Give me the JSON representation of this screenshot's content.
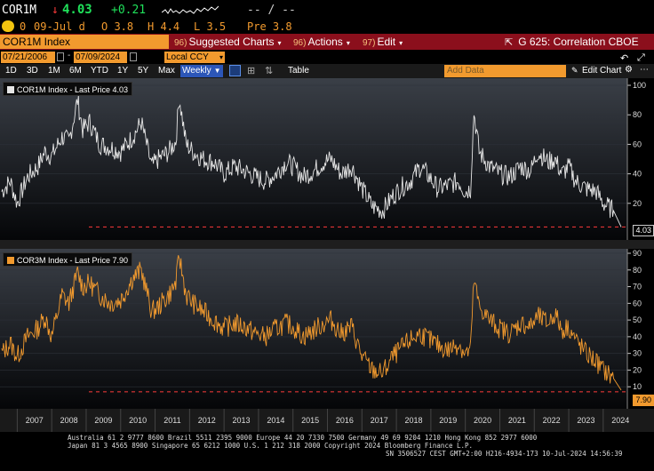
{
  "ticker": {
    "symbol": "COR1M",
    "arrow": "↓",
    "last": "4.03",
    "change": "+0.21",
    "trail": "-- / --"
  },
  "ohlc": {
    "badge": "0",
    "date": "09-Jul d",
    "open": "O 3.8",
    "high": "H 4.4",
    "low": "L 3.5",
    "prev": "Pre 3.8"
  },
  "commandbar": {
    "security": "COR1M Index",
    "menus": [
      {
        "num": "96)",
        "label": "Suggested Charts"
      },
      {
        "num": "96)",
        "label": "Actions"
      },
      {
        "num": "97)",
        "label": "Edit"
      }
    ],
    "title": "G 625: Correlation CBOE"
  },
  "dates": {
    "start": "07/21/2006",
    "end": "07/09/2024",
    "currency": "Local CCY"
  },
  "toolbar": {
    "periods": [
      "1D",
      "3D",
      "1M",
      "6M",
      "YTD",
      "1Y",
      "5Y",
      "Max"
    ],
    "frequency": "Weekly",
    "table": "Table",
    "add_data": "Add Data",
    "edit_chart": "Edit Chart"
  },
  "colors": {
    "series1": "#e6e6e6",
    "series2": "#f29a2e",
    "reference": "#ff3b3b",
    "bar": "#8b0f1c"
  },
  "chart_data": [
    {
      "type": "line",
      "name": "COR1M Index - Last Price 4.03",
      "last": "4.03",
      "ylim": [
        0,
        100
      ],
      "yticks": [
        20,
        40,
        60,
        80,
        100
      ],
      "reference_y": 4,
      "x": [
        2006.55,
        2006.8,
        2007.0,
        2007.3,
        2007.6,
        2007.8,
        2008.0,
        2008.3,
        2008.5,
        2008.75,
        2008.9,
        2009.1,
        2009.4,
        2009.7,
        2010.0,
        2010.35,
        2010.6,
        2010.9,
        2011.1,
        2011.4,
        2011.6,
        2011.7,
        2011.9,
        2012.1,
        2012.4,
        2012.7,
        2013.0,
        2013.3,
        2013.6,
        2013.9,
        2014.2,
        2014.5,
        2014.8,
        2015.0,
        2015.3,
        2015.6,
        2015.9,
        2016.1,
        2016.4,
        2016.7,
        2017.0,
        2017.3,
        2017.6,
        2017.9,
        2018.1,
        2018.4,
        2018.7,
        2018.95,
        2019.2,
        2019.5,
        2019.8,
        2020.0,
        2020.15,
        2020.25,
        2020.4,
        2020.7,
        2021.0,
        2021.3,
        2021.6,
        2021.9,
        2022.1,
        2022.4,
        2022.6,
        2022.8,
        2023.0,
        2023.2,
        2023.5,
        2023.8,
        2024.0,
        2024.3,
        2024.52
      ],
      "y": [
        28,
        35,
        20,
        38,
        45,
        55,
        52,
        65,
        62,
        90,
        70,
        75,
        60,
        58,
        55,
        65,
        75,
        45,
        50,
        55,
        62,
        92,
        60,
        55,
        50,
        48,
        40,
        45,
        42,
        38,
        35,
        40,
        48,
        45,
        38,
        42,
        48,
        50,
        40,
        45,
        30,
        18,
        15,
        25,
        30,
        35,
        45,
        38,
        30,
        32,
        35,
        28,
        30,
        82,
        55,
        45,
        40,
        38,
        45,
        42,
        55,
        48,
        50,
        40,
        45,
        35,
        30,
        28,
        20,
        15,
        4
      ]
    },
    {
      "type": "line",
      "name": "COR3M Index - Last Price 7.90",
      "last": "7.90",
      "ylim": [
        0,
        90
      ],
      "yticks": [
        10,
        20,
        30,
        40,
        50,
        60,
        70,
        80,
        90
      ],
      "reference_y": 7,
      "x": [
        2006.55,
        2006.8,
        2007.0,
        2007.3,
        2007.6,
        2007.8,
        2008.0,
        2008.3,
        2008.5,
        2008.75,
        2008.9,
        2009.1,
        2009.4,
        2009.7,
        2010.0,
        2010.35,
        2010.6,
        2010.9,
        2011.1,
        2011.4,
        2011.6,
        2011.7,
        2011.9,
        2012.1,
        2012.4,
        2012.7,
        2013.0,
        2013.3,
        2013.6,
        2013.9,
        2014.2,
        2014.5,
        2014.8,
        2015.0,
        2015.3,
        2015.6,
        2015.9,
        2016.1,
        2016.4,
        2016.7,
        2017.0,
        2017.3,
        2017.6,
        2017.9,
        2018.1,
        2018.4,
        2018.7,
        2018.95,
        2019.2,
        2019.5,
        2019.8,
        2020.0,
        2020.15,
        2020.25,
        2020.4,
        2020.7,
        2021.0,
        2021.3,
        2021.6,
        2021.9,
        2022.1,
        2022.4,
        2022.6,
        2022.8,
        2023.0,
        2023.2,
        2023.5,
        2023.8,
        2024.0,
        2024.3,
        2024.52
      ],
      "y": [
        30,
        36,
        28,
        40,
        45,
        52,
        40,
        65,
        60,
        78,
        70,
        72,
        65,
        60,
        62,
        75,
        80,
        55,
        58,
        65,
        72,
        88,
        65,
        60,
        55,
        50,
        45,
        48,
        46,
        42,
        40,
        45,
        48,
        46,
        40,
        44,
        48,
        50,
        42,
        46,
        28,
        20,
        18,
        28,
        32,
        38,
        42,
        38,
        35,
        32,
        36,
        30,
        32,
        74,
        58,
        50,
        45,
        42,
        48,
        46,
        52,
        48,
        54,
        44,
        46,
        38,
        30,
        25,
        20,
        15,
        8
      ]
    }
  ],
  "xaxis": {
    "labels": [
      "2007",
      "2008",
      "2009",
      "2010",
      "2011",
      "2012",
      "2013",
      "2014",
      "2015",
      "2016",
      "2017",
      "2018",
      "2019",
      "2020",
      "2021",
      "2022",
      "2023",
      "2024"
    ]
  },
  "footer": {
    "line1": "Australia 61 2 9777 8600 Brazil 5511 2395 9000 Europe 44 20 7330 7500 Germany 49 69 9204 1210 Hong Kong 852 2977 6000",
    "line2": "Japan 81 3 4565 8900          Singapore 65 6212 1000          U.S. 1 212 318 2000            Copyright 2024 Bloomberg Finance L.P.",
    "line3": "SN 3506527 CEST GMT+2:00 H216-4934-173 10-Jul-2024 14:56:39"
  }
}
